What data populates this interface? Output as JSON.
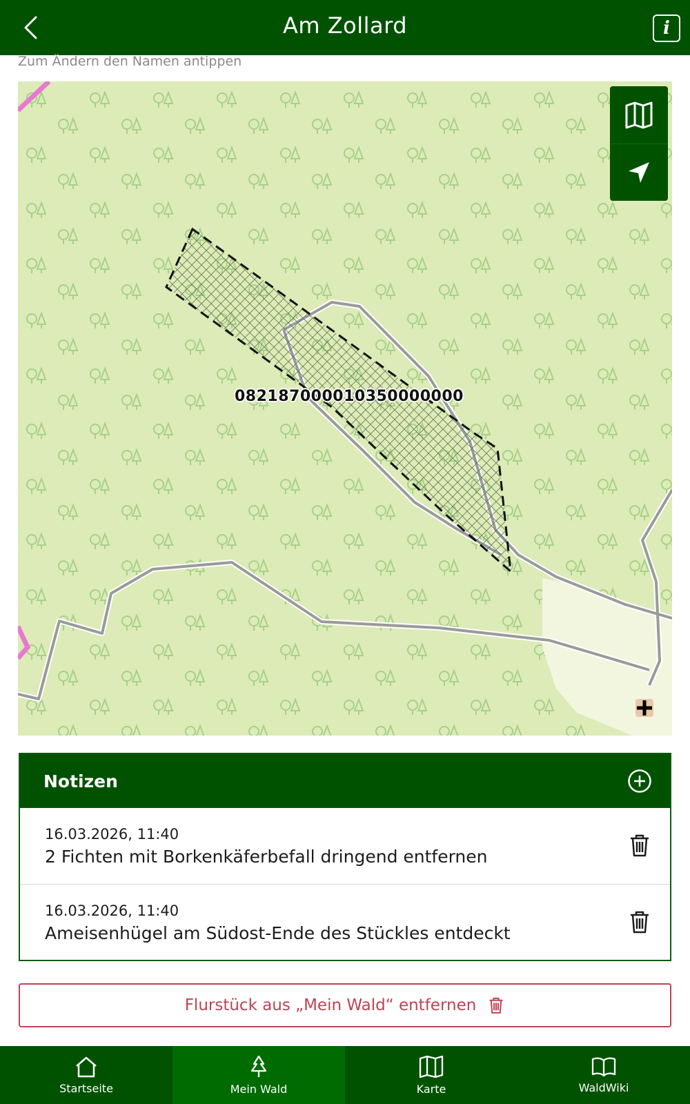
{
  "header": {
    "title": "Am Zollard",
    "back_icon": "chevron-left-icon",
    "info_icon": "info-icon"
  },
  "hint": "Zum Ändern den Namen antippen",
  "map": {
    "parcel_id": "082187000010350000000",
    "controls": [
      {
        "icon": "map-icon"
      },
      {
        "icon": "location-arrow-icon"
      }
    ],
    "colors": {
      "forest": "#dcebb7",
      "meadow": "#f2f6df",
      "path": "#9a9a9a",
      "boundary": "#e878d0",
      "tree": "#a8d08a"
    }
  },
  "notes": {
    "title": "Notizen",
    "items": [
      {
        "date": "16.03.2026, 11:40",
        "text": "2 Fichten mit Borkenkäferbefall dringend entfernen"
      },
      {
        "date": "16.03.2026, 11:40",
        "text": "Ameisenhügel am Südost-Ende des Stückles entdeckt"
      }
    ]
  },
  "remove_button": {
    "label": "Flurstück aus „Mein Wald“ entfernen"
  },
  "nav": {
    "items": [
      {
        "label": "Startseite",
        "icon": "home-icon",
        "active": false
      },
      {
        "label": "Mein Wald",
        "icon": "tree-icon",
        "active": true
      },
      {
        "label": "Karte",
        "icon": "map-icon",
        "active": false
      },
      {
        "label": "WaldWiki",
        "icon": "book-icon",
        "active": false
      }
    ]
  },
  "colors": {
    "primary": "#005200",
    "active_tab": "#006b00",
    "danger": "#c04252"
  }
}
